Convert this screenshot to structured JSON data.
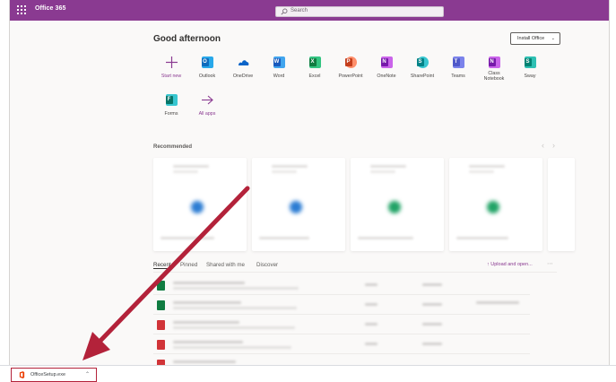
{
  "suite_bar": {
    "app_title": "Office 365",
    "search_placeholder": "Search",
    "color": "#8a3a91"
  },
  "greeting": "Good afternoon",
  "install_button": {
    "label": "Install Office",
    "chevron": "chevron-down-icon"
  },
  "apps": [
    {
      "label": "Start new",
      "icon": "plus-icon"
    },
    {
      "label": "Outlook",
      "icon": "outlook-icon",
      "color": "#0f6cbd",
      "letter": "O"
    },
    {
      "label": "OneDrive",
      "icon": "onedrive-icon",
      "color": "#0a64c8"
    },
    {
      "label": "Word",
      "icon": "word-icon",
      "color": "#185abd",
      "letter": "W"
    },
    {
      "label": "Excel",
      "icon": "excel-icon",
      "color": "#107c41",
      "letter": "X"
    },
    {
      "label": "PowerPoint",
      "icon": "powerpoint-icon",
      "color": "#c43e1c",
      "letter": "P"
    },
    {
      "label": "OneNote",
      "icon": "onenote-icon",
      "color": "#7719aa",
      "letter": "N"
    },
    {
      "label": "SharePoint",
      "icon": "sharepoint-icon",
      "color": "#038387",
      "letter": "S"
    },
    {
      "label": "Teams",
      "icon": "teams-icon",
      "color": "#5059c9",
      "letter": "T"
    },
    {
      "label": "Class Notebook",
      "icon": "class-notebook-icon",
      "color": "#7719aa",
      "letter": "N"
    },
    {
      "label": "Sway",
      "icon": "sway-icon",
      "color": "#008272",
      "letter": "S"
    },
    {
      "label": "Forms",
      "icon": "forms-icon",
      "color": "#077568",
      "letter": "F"
    },
    {
      "label": "All apps",
      "icon": "arrow-right-icon"
    }
  ],
  "recommended": {
    "title": "Recommended",
    "cards": [
      {
        "dot_color": "#2b7cd3"
      },
      {
        "dot_color": "#2b7cd3"
      },
      {
        "dot_color": "#21a366"
      },
      {
        "dot_color": "#21a366"
      }
    ]
  },
  "file_tabs": {
    "recent": "Recent",
    "pinned": "Pinned",
    "shared": "Shared with me",
    "discover": "Discover",
    "upload": "Upload and open..."
  },
  "file_rows": [
    {
      "icon": "excel-file-icon",
      "color": "#107c41"
    },
    {
      "icon": "excel-file-icon",
      "color": "#107c41"
    },
    {
      "icon": "pdf-file-icon",
      "color": "#d13438"
    },
    {
      "icon": "pdf-file-icon",
      "color": "#d13438"
    },
    {
      "icon": "pdf-file-icon",
      "color": "#d13438"
    }
  ],
  "download": {
    "filename": "OfficeSetup.exe",
    "highlight_color": "#b3223a"
  },
  "annotation": {
    "arrow_color": "#b3223a"
  }
}
